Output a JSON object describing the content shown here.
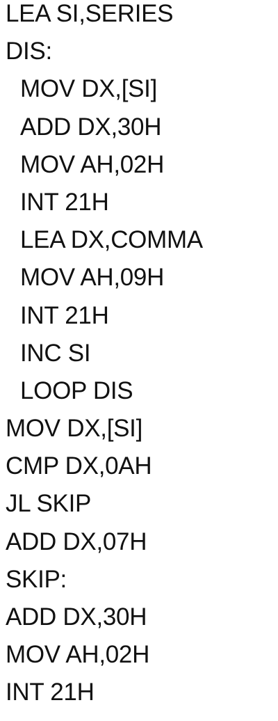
{
  "code": {
    "lines": [
      "LEA SI,SERIES",
      "DIS:",
      "MOV DX,[SI]",
      "ADD DX,30H",
      "MOV AH,02H",
      "INT 21H",
      "LEA DX,COMMA",
      "MOV AH,09H",
      "INT 21H",
      "INC SI",
      "LOOP DIS",
      "MOV DX,[SI]",
      "CMP DX,0AH",
      "JL SKIP",
      "ADD DX,07H",
      "SKIP:",
      "ADD DX,30H",
      "MOV AH,02H",
      "INT 21H"
    ]
  }
}
